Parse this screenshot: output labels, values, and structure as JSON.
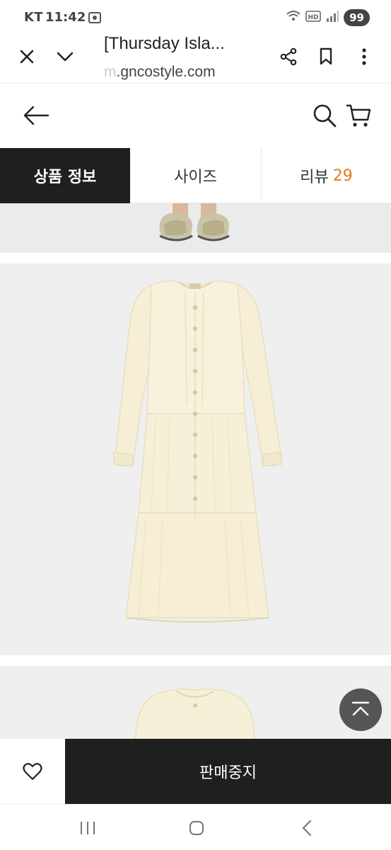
{
  "status_bar": {
    "carrier": "KT",
    "time": "11:42",
    "notification_count": "99",
    "icons": [
      "screen-record-icon",
      "wifi-calling-icon",
      "hd-icon",
      "signal-icon"
    ]
  },
  "browser": {
    "title": "[Thursday Isla...",
    "url_prefix_faded": "m",
    "url": ".gncostyle.com",
    "icons": [
      "close-icon",
      "chevron-down-icon",
      "share-icon",
      "bookmark-icon",
      "more-vert-icon"
    ]
  },
  "site_header": {
    "icons": [
      "back-arrow-icon",
      "search-icon",
      "cart-icon"
    ]
  },
  "tabs": [
    {
      "label": "상품 정보",
      "active": true
    },
    {
      "label": "사이즈",
      "active": false
    },
    {
      "label": "리뷰",
      "count": "29",
      "active": false
    }
  ],
  "action_bar": {
    "buy_label": "판매중지",
    "wish_icon": "heart-icon"
  },
  "colors": {
    "dark": "#1f1f1f",
    "accent": "#e07a1f",
    "dress": "#f7f1dc"
  }
}
